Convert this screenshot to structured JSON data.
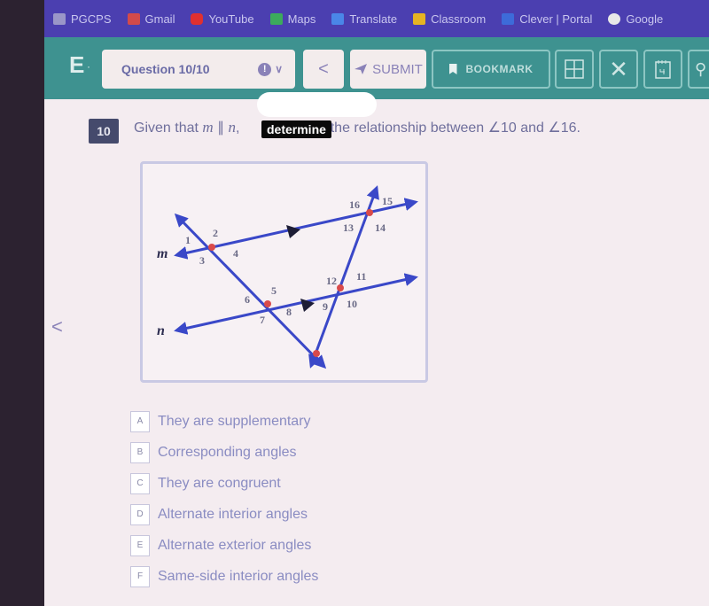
{
  "bookmarks": [
    {
      "label": "PGCPS",
      "icon": "folder-icon",
      "color": "#9a96c8"
    },
    {
      "label": "Gmail",
      "icon": "gmail-icon",
      "color": "#d34a4a"
    },
    {
      "label": "YouTube",
      "icon": "youtube-icon",
      "color": "#e03030"
    },
    {
      "label": "Maps",
      "icon": "maps-icon",
      "color": "#3caa5c"
    },
    {
      "label": "Translate",
      "icon": "translate-icon",
      "color": "#4a86e8"
    },
    {
      "label": "Classroom",
      "icon": "classroom-icon",
      "color": "#e6b422"
    },
    {
      "label": "Clever | Portal",
      "icon": "clever-icon",
      "color": "#3d6bd9"
    },
    {
      "label": "Google",
      "icon": "google-icon",
      "color": "#e8e8e8"
    }
  ],
  "toolbar": {
    "brand": "E",
    "question_select": "Question 10/10",
    "info_glyph": "!",
    "chevron": "∨",
    "prev_glyph": "<",
    "submit_label": "SUBMIT",
    "bookmark_label": "BOOKMARK",
    "close_glyph": "✕",
    "search_glyph": "⚲"
  },
  "question": {
    "number": "10",
    "prompt_prefix": "Given that ",
    "var_m": "m",
    "parallel": " ∥ ",
    "var_n": "n",
    "prompt_suffix": ",                       the relationship between ∠10 and ∠16.",
    "tooltip": "determine",
    "left_nav": "<"
  },
  "figure": {
    "line_labels": {
      "m": "m",
      "n": "n"
    },
    "angle_labels": [
      "1",
      "2",
      "3",
      "4",
      "5",
      "6",
      "7",
      "8",
      "9",
      "10",
      "11",
      "12",
      "13",
      "14",
      "15",
      "16"
    ],
    "colors": {
      "line": "#3a48c8",
      "point": "#d94a4a"
    }
  },
  "choices": [
    {
      "letter": "A",
      "text": "They are supplementary"
    },
    {
      "letter": "B",
      "text": "Corresponding angles"
    },
    {
      "letter": "C",
      "text": "They are congruent"
    },
    {
      "letter": "D",
      "text": "Alternate interior angles"
    },
    {
      "letter": "E",
      "text": "Alternate exterior angles"
    },
    {
      "letter": "F",
      "text": "Same-side interior angles"
    }
  ]
}
